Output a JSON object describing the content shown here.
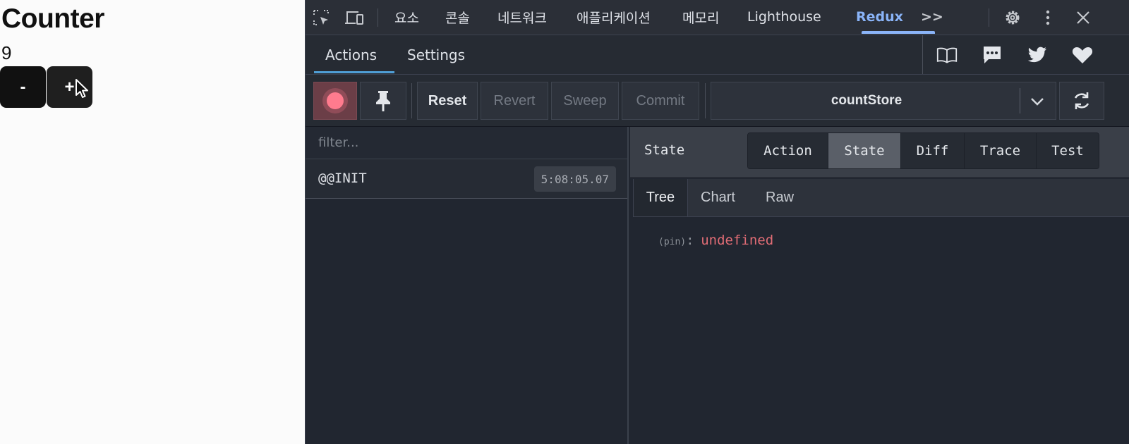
{
  "app": {
    "title": "Counter",
    "count": "9",
    "minus_label": "-",
    "plus_label": "+"
  },
  "devtools": {
    "tabs": [
      "요소",
      "콘솔",
      "네트워크",
      "애플리케이션",
      "메모리",
      "Lighthouse",
      "Redux"
    ],
    "active_tab": "Redux",
    "more_tabs": ">>",
    "icons": [
      "inspect-element-icon",
      "device-toolbar-icon",
      "settings-gear-icon",
      "more-options-icon",
      "close-icon"
    ]
  },
  "redux": {
    "tabs": [
      "Actions",
      "Settings"
    ],
    "active_tab": "Actions",
    "header_icons": [
      "book-icon",
      "chat-icon",
      "twitter-icon",
      "heart-icon"
    ],
    "toolbar": {
      "reset": "Reset",
      "revert": "Revert",
      "sweep": "Sweep",
      "commit": "Commit",
      "store": "countStore"
    },
    "filter_placeholder": "filter...",
    "actions": [
      {
        "name": "@@INIT",
        "time": "5:08:05.07"
      }
    ],
    "panel": {
      "title": "State",
      "modes": [
        "Action",
        "State",
        "Diff",
        "Trace",
        "Test"
      ],
      "active_mode": "State",
      "sub_tabs": [
        "Tree",
        "Chart",
        "Raw"
      ],
      "active_sub_tab": "Tree",
      "tree": {
        "key": "(pin)",
        "colon": ":",
        "value": "undefined"
      }
    }
  },
  "colors": {
    "accent_blue": "#8ab4f8",
    "record_active": "#ff7b8e",
    "value_red": "#e06c75"
  }
}
